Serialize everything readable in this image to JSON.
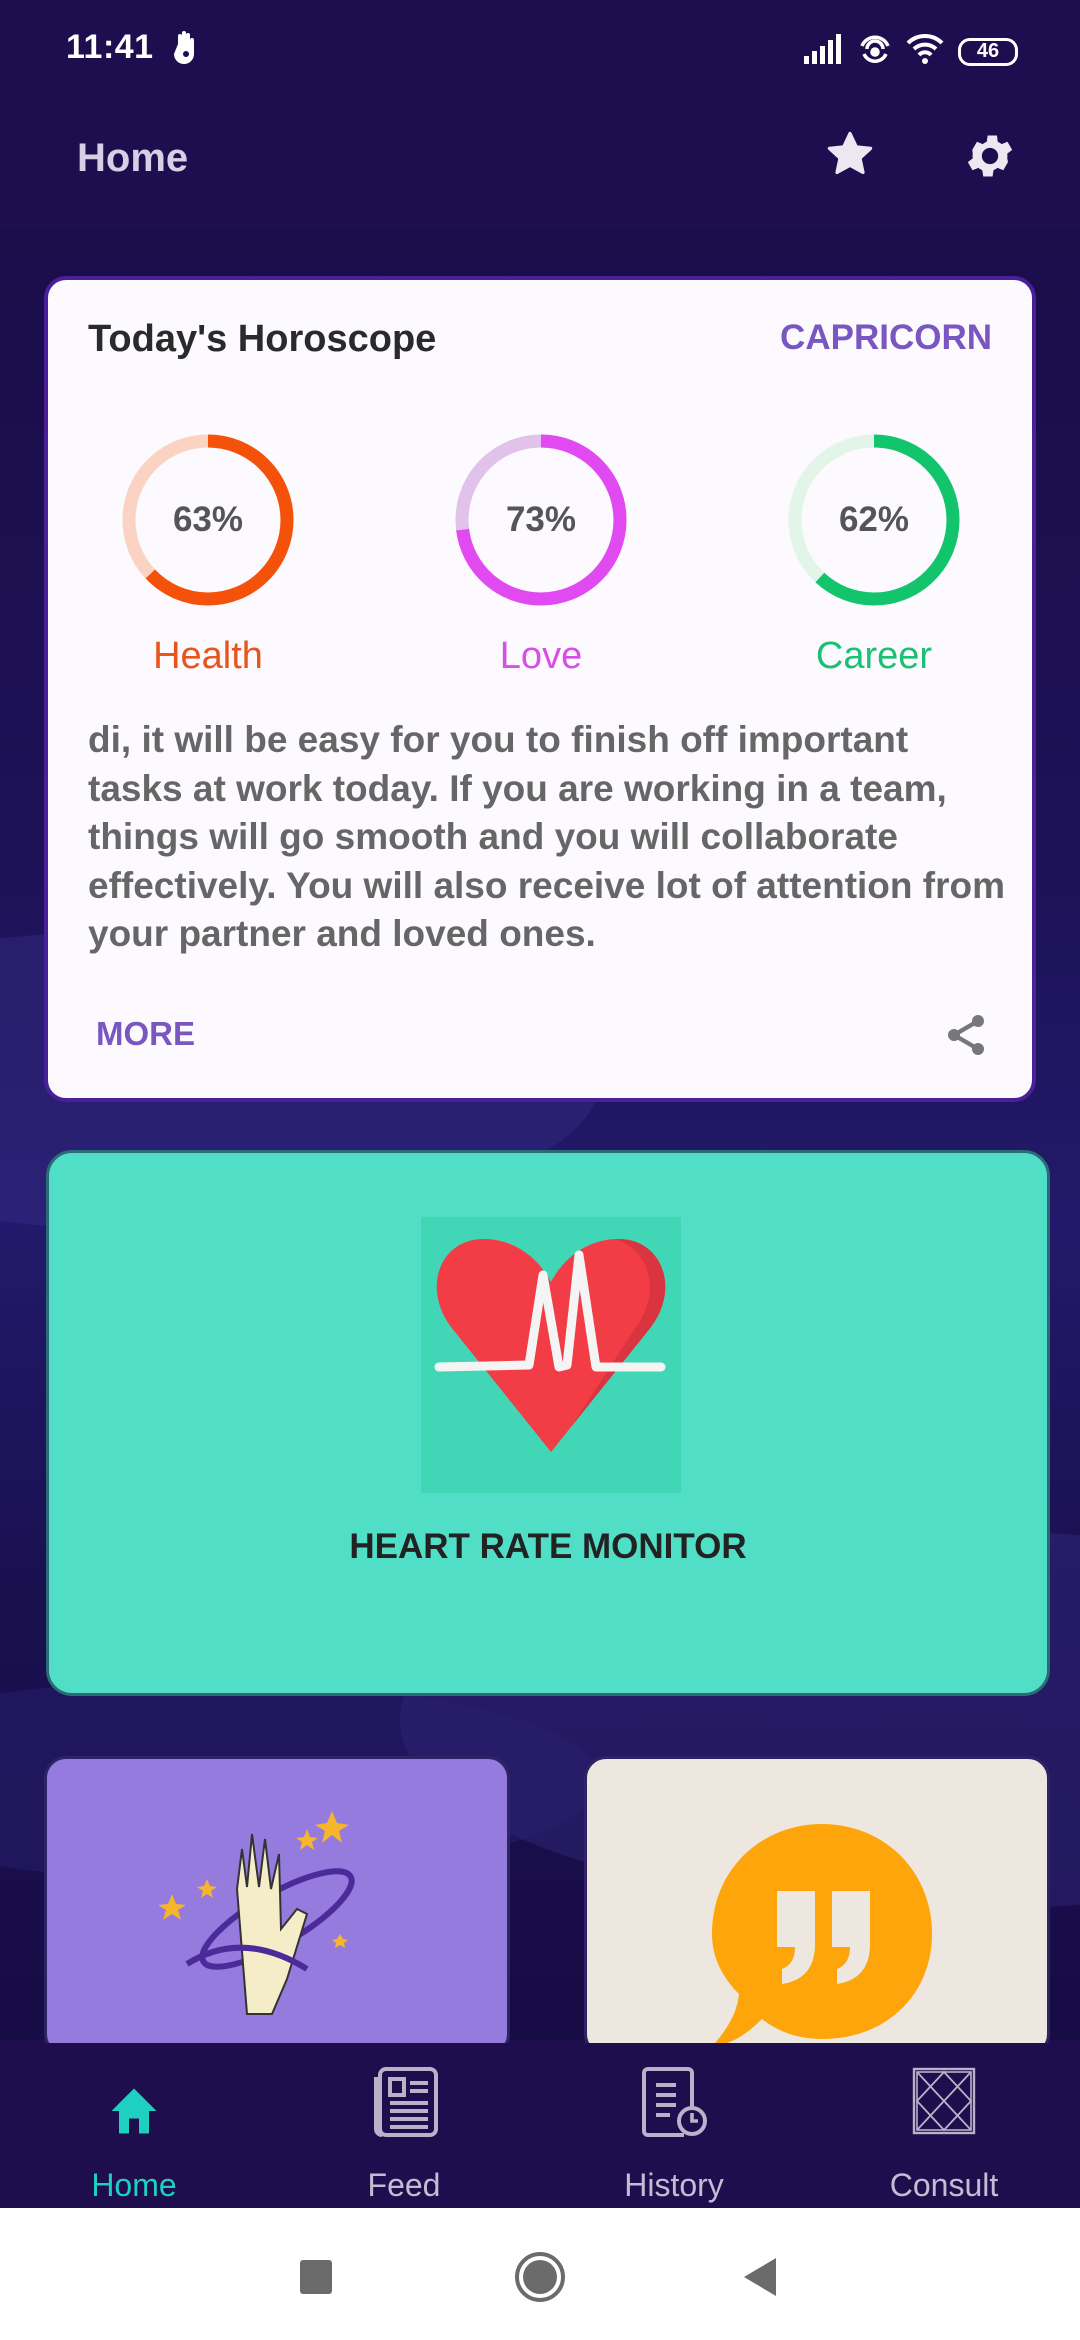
{
  "status_bar": {
    "time": "11:41",
    "battery": "46"
  },
  "app_bar": {
    "title": "Home",
    "icons": [
      "star-icon",
      "settings-gear-icon"
    ]
  },
  "horoscope": {
    "title": "Today's Horoscope",
    "sign": "CAPRICORN",
    "meters": [
      {
        "label": "Health",
        "value": "63%",
        "percent": 63,
        "color": "#f4510b",
        "track": "#fbd3c2"
      },
      {
        "label": "Love",
        "value": "73%",
        "percent": 73,
        "color": "#e04af0",
        "track": "#e0c2ea"
      },
      {
        "label": "Career",
        "value": "62%",
        "percent": 62,
        "color": "#12c46c",
        "track": "#e3f5e9"
      }
    ],
    "description": "di, it will be easy for you to finish off important tasks at work today. If you are working in a team, things will go smooth and you will collaborate effectively. You will also receive lot of attention from your partner and loved ones.",
    "more_label": "MORE"
  },
  "feature_card": {
    "label": "HEART RATE MONITOR",
    "icon": "heart-pulse-icon"
  },
  "small_cards": [
    {
      "icon": "palm-reading-icon",
      "bg": "#957bde"
    },
    {
      "icon": "quote-bubble-icon",
      "bg": "#ede7e0"
    }
  ],
  "bottom_nav": {
    "items": [
      {
        "label": "Home",
        "icon": "home-icon",
        "active": true
      },
      {
        "label": "Feed",
        "icon": "newspaper-icon",
        "active": false
      },
      {
        "label": "History",
        "icon": "history-document-icon",
        "active": false
      },
      {
        "label": "Consult",
        "icon": "kundli-chart-icon",
        "active": false
      }
    ],
    "active_color": "#1fcfc0"
  }
}
